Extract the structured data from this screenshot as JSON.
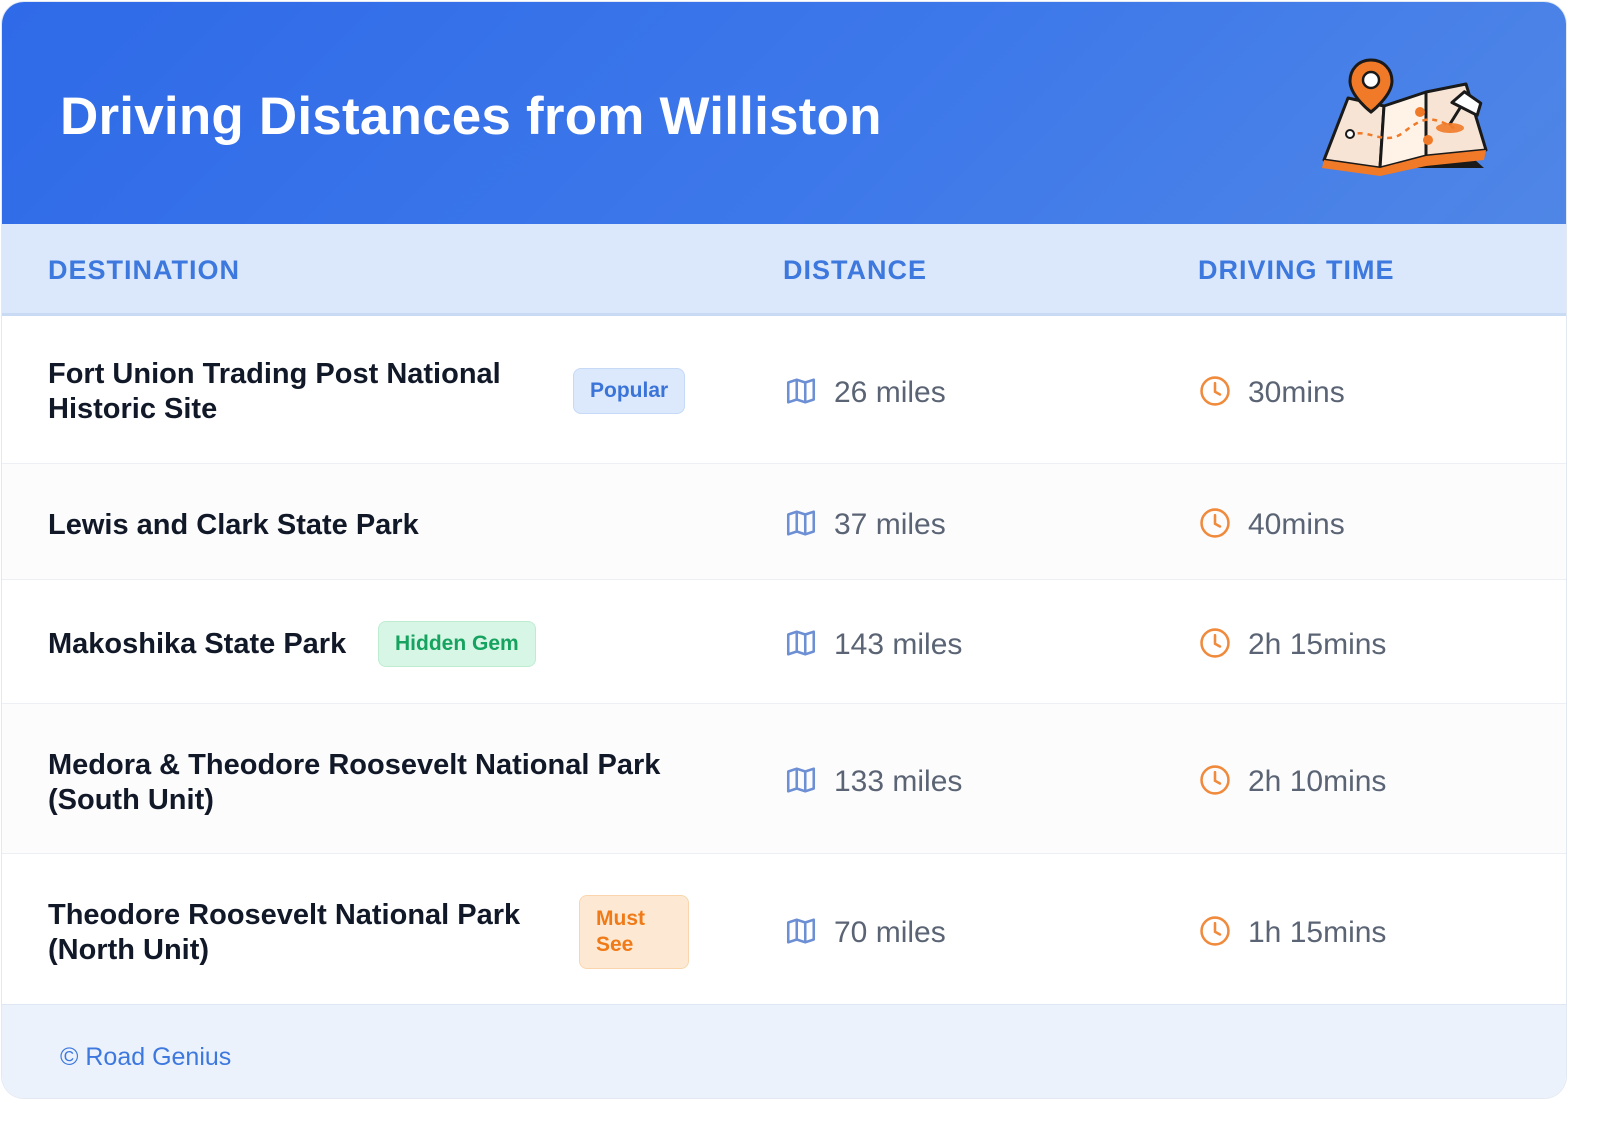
{
  "title": "Driving Distances from Williston",
  "columns": {
    "destination": "DESTINATION",
    "distance": "DISTANCE",
    "driving_time": "DRIVING TIME"
  },
  "rows": [
    {
      "destination_line1": "Fort Union Trading Post National",
      "destination_line2": "Historic Site",
      "badge": "Popular",
      "distance": "26 miles",
      "time": "30mins"
    },
    {
      "destination_line1": "Lewis and Clark State Park",
      "destination_line2": "",
      "badge": "",
      "distance": "37 miles",
      "time": "40mins"
    },
    {
      "destination_line1": "Makoshika State Park",
      "destination_line2": "",
      "badge": "Hidden Gem",
      "distance": "143 miles",
      "time": "2h 15mins"
    },
    {
      "destination_line1": "Medora & Theodore Roosevelt National Park",
      "destination_line2": "(South Unit)",
      "badge": "",
      "distance": "133 miles",
      "time": "2h 10mins"
    },
    {
      "destination_line1": "Theodore Roosevelt National Park",
      "destination_line2": "(North Unit)",
      "badge": "Must See",
      "distance": "70 miles",
      "time": "1h 15mins"
    }
  ],
  "footer": {
    "credit": "© Road Genius"
  },
  "icons": {
    "distance": "map-icon",
    "time": "clock-icon",
    "header": "map-pin-illustration"
  },
  "colors": {
    "header": "#2f6ae8",
    "accent": "#3d78de",
    "orange": "#f08a3c"
  }
}
